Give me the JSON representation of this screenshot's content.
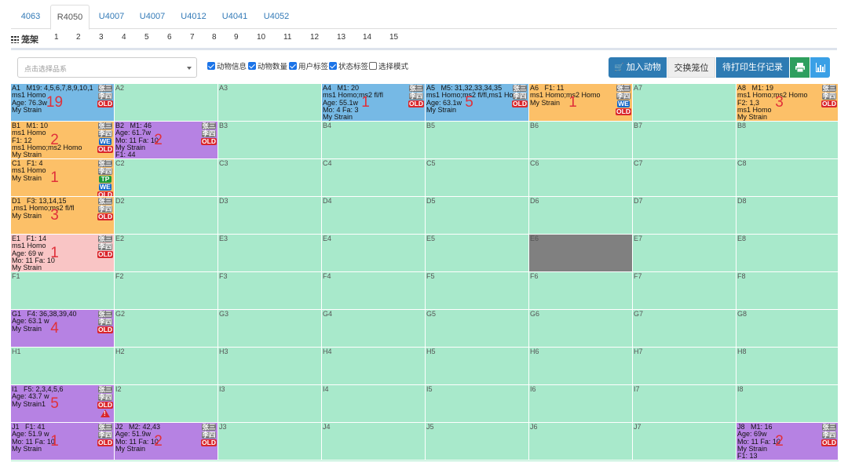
{
  "tabs": [
    "4063",
    "R4050",
    "U4007",
    "U4007",
    "U4012",
    "U4041",
    "U4052"
  ],
  "active_tab": 1,
  "rack": {
    "label": "笼架",
    "numbers": [
      "1",
      "2",
      "3",
      "4",
      "5",
      "6",
      "7",
      "8",
      "9",
      "10",
      "11",
      "12",
      "13",
      "14",
      "15"
    ]
  },
  "toolbar": {
    "strain_placeholder": "点击选择品系",
    "checkboxes": [
      {
        "label": "动物信息",
        "checked": true
      },
      {
        "label": "动物数量",
        "checked": true
      },
      {
        "label": "用户标签",
        "checked": true
      },
      {
        "label": "状态标签",
        "checked": true
      },
      {
        "label": "选择模式",
        "checked": false
      }
    ],
    "add_animal": "加入动物",
    "swap": "交换笼位",
    "print_records": "待打印生仔记录",
    "print_icon": "printer-icon",
    "chart_icon": "bar-chart-icon"
  },
  "colors": {
    "empty": "#a8e9cb",
    "blue": "#76b9e5",
    "orange": "#fcc068",
    "purple": "#b682e3",
    "pink": "#f9c5c5",
    "disabled": "#808080",
    "accent": "#2e7bb3",
    "red": "#e0303a"
  },
  "rows": [
    "A",
    "B",
    "C",
    "D",
    "E",
    "F",
    "G",
    "H",
    "I",
    "J"
  ],
  "cols": 8,
  "cages": {
    "A1": {
      "color": "blue",
      "lines": [
        "   M19: 4,5,6,7,8,9,10,1",
        "ms1 Homo",
        "Age: 76.3w",
        "My Strain"
      ],
      "count": "19",
      "tags": [
        "张三",
        "李四",
        "OLD"
      ]
    },
    "A4": {
      "color": "blue",
      "lines": [
        "   M1: 20",
        "ms1 Homo;ms2 fl/fl",
        "Age: 55.1w",
        "Mo: 4 Fa: 3",
        "My Strain"
      ],
      "count": "1",
      "tags": [
        "张三",
        "李四",
        "OLD"
      ]
    },
    "A5": {
      "color": "blue",
      "lines": [
        "   M5: 31,32,33,34,35",
        "ms1 Homo;ms2 fl/fl,ms1 Ho",
        "Age: 63.1w",
        "My Strain"
      ],
      "count": "5",
      "tags": [
        "张三",
        "李四",
        "OLD"
      ]
    },
    "A6": {
      "color": "orange",
      "lines": [
        "   F1: 11",
        "ms1 Homo;ms2 Homo",
        "My Strain"
      ],
      "count": "1",
      "tags": [
        "张三",
        "李四",
        "WE",
        "OLD"
      ]
    },
    "A8": {
      "color": "orange",
      "lines": [
        "   M1: 19",
        "ms1 Homo;ms2 Homo",
        "F2: 1,3",
        "ms1 Homo",
        "My Strain"
      ],
      "count": "3",
      "tags": [
        "张三",
        "李四",
        "OLD"
      ]
    },
    "B1": {
      "color": "orange",
      "lines": [
        "   M1: 10",
        "ms1 Homo",
        "F1: 12",
        "ms1 Homo;ms2 Homo",
        "My Strain"
      ],
      "count": "2",
      "tags": [
        "张三",
        "李四",
        "WE",
        "OLD"
      ]
    },
    "B2": {
      "color": "purple",
      "lines": [
        "   M1: 46",
        "Age: 61.7w",
        "Mo: 11 Fa: 10",
        "My Strain",
        "F1: 44"
      ],
      "count": "2",
      "tags": [
        "张三",
        "李四",
        "OLD"
      ]
    },
    "C1": {
      "color": "orange",
      "lines": [
        "   F1: 4",
        "ms1 Homo",
        "My Strain"
      ],
      "count": "1",
      "tags": [
        "张三",
        "李四",
        "TP",
        "WE",
        "OLD"
      ]
    },
    "D1": {
      "color": "orange",
      "lines": [
        "   F3: 13,14,15",
        ",ms1 Homo;ms2 fl/fl",
        "My Strain"
      ],
      "count": "3",
      "tags": [
        "张三",
        "李四",
        "OLD"
      ]
    },
    "E1": {
      "color": "pink",
      "lines": [
        "   F1: 14",
        "ms1 Homo",
        "Age: 69 w",
        "Mo: 11 Fa: 10",
        "My Strain"
      ],
      "count": "1",
      "tags": [
        "张三",
        "李四",
        "OLD"
      ]
    },
    "E6": {
      "color": "disabled",
      "lines": [],
      "count": "",
      "tags": []
    },
    "G1": {
      "color": "purple",
      "lines": [
        "   F4: 36,38,39,40",
        "Age: 63.1 w",
        "My Strain"
      ],
      "count": "4",
      "tags": [
        "张三",
        "李四",
        "OLD"
      ]
    },
    "I1": {
      "color": "purple",
      "lines": [
        "   F5: 2,3,4,5,6",
        "Age: 43.7 w",
        "My Strain1"
      ],
      "count": "5",
      "tags": [
        "张三",
        "李四",
        "OLD",
        "WARN"
      ]
    },
    "J1": {
      "color": "purple",
      "lines": [
        "   F1: 41",
        "Age: 51.9 w",
        "Mo: 11 Fa: 10",
        "My Strain"
      ],
      "count": "1",
      "tags": [
        "张三",
        "李四",
        "OLD"
      ]
    },
    "J2": {
      "color": "purple",
      "lines": [
        "   M2: 42,43",
        "Age: 51.9w",
        "Mo: 11 Fa: 10",
        "My Strain"
      ],
      "count": "2",
      "tags": [
        "张三",
        "李四",
        "OLD"
      ]
    },
    "J8": {
      "color": "purple",
      "lines": [
        "   M1: 16",
        "Age: 69w",
        "Mo: 11 Fa: 10",
        "My Strain",
        "F1: 13"
      ],
      "count": "2",
      "tags": [
        "张三",
        "李四",
        "OLD"
      ]
    }
  }
}
